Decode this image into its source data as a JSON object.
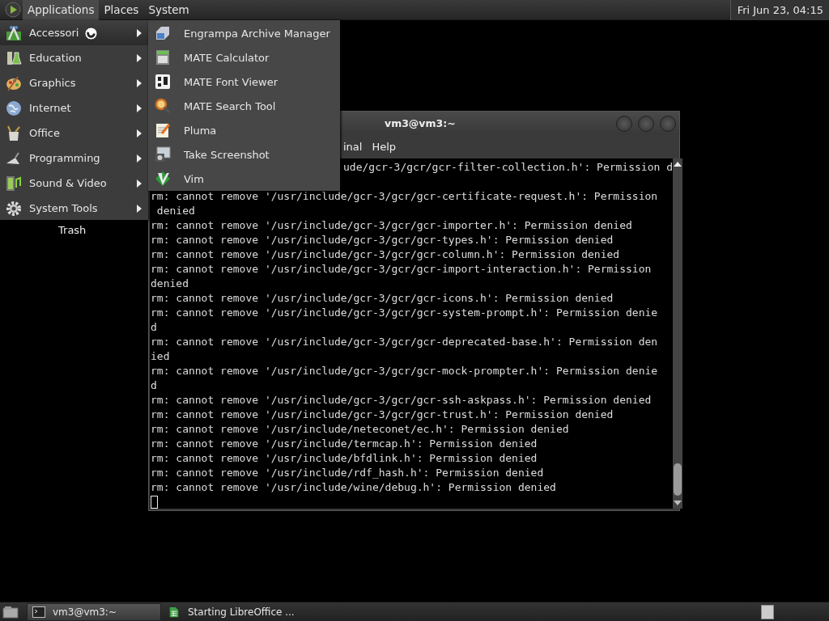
{
  "top_panel": {
    "menus": [
      {
        "label": "Applications",
        "selected": true
      },
      {
        "label": "Places",
        "selected": false
      },
      {
        "label": "System",
        "selected": false
      }
    ],
    "clock": "Fri Jun 23, 04:15"
  },
  "applications_menu": {
    "items": [
      {
        "label": "Accessori",
        "kind": "accessories",
        "selected": true
      },
      {
        "label": "Education",
        "kind": "education",
        "selected": false
      },
      {
        "label": "Graphics",
        "kind": "graphics",
        "selected": false
      },
      {
        "label": "Internet",
        "kind": "internet",
        "selected": false
      },
      {
        "label": "Office",
        "kind": "office",
        "selected": false
      },
      {
        "label": "Programming",
        "kind": "programming",
        "selected": false
      },
      {
        "label": "Sound & Video",
        "kind": "sound_video",
        "selected": false
      },
      {
        "label": "System Tools",
        "kind": "system",
        "selected": false
      }
    ]
  },
  "submenu": {
    "items": [
      {
        "label": "Engrampa Archive Manager",
        "kind": "archive"
      },
      {
        "label": "MATE Calculator",
        "kind": "calculator"
      },
      {
        "label": "MATE Font Viewer",
        "kind": "font"
      },
      {
        "label": "MATE Search Tool",
        "kind": "search"
      },
      {
        "label": "Pluma",
        "kind": "editor"
      },
      {
        "label": "Take Screenshot",
        "kind": "screenshot"
      },
      {
        "label": "Vim",
        "kind": "vim"
      }
    ]
  },
  "desktop_icons": [
    {
      "label": "Trash"
    }
  ],
  "terminal": {
    "title": "vm3@vm3:~",
    "menus": [
      "inal",
      "Help"
    ],
    "first_line": "ude/gcr-3/gcr/gcr-filter-collection.h': Permission d",
    "lines": [
      "rm: cannot remove '/usr/include/gcr-3/gcr/gcr-certificate-request.h': Permission",
      " denied",
      "rm: cannot remove '/usr/include/gcr-3/gcr/gcr-importer.h': Permission denied",
      "rm: cannot remove '/usr/include/gcr-3/gcr/gcr-types.h': Permission denied",
      "rm: cannot remove '/usr/include/gcr-3/gcr/gcr-column.h': Permission denied",
      "rm: cannot remove '/usr/include/gcr-3/gcr/gcr-import-interaction.h': Permission",
      "denied",
      "rm: cannot remove '/usr/include/gcr-3/gcr/gcr-icons.h': Permission denied",
      "rm: cannot remove '/usr/include/gcr-3/gcr/gcr-system-prompt.h': Permission denie",
      "d",
      "rm: cannot remove '/usr/include/gcr-3/gcr/gcr-deprecated-base.h': Permission den",
      "ied",
      "rm: cannot remove '/usr/include/gcr-3/gcr/gcr-mock-prompter.h': Permission denie",
      "d",
      "rm: cannot remove '/usr/include/gcr-3/gcr/gcr-ssh-askpass.h': Permission denied",
      "rm: cannot remove '/usr/include/gcr-3/gcr/gcr-trust.h': Permission denied",
      "rm: cannot remove '/usr/include/neteconet/ec.h': Permission denied",
      "rm: cannot remove '/usr/include/termcap.h': Permission denied",
      "rm: cannot remove '/usr/include/bfdlink.h': Permission denied",
      "rm: cannot remove '/usr/include/rdf_hash.h': Permission denied",
      "rm: cannot remove '/usr/include/wine/debug.h': Permission denied"
    ]
  },
  "taskbar": {
    "tasks": [
      {
        "label": "vm3@vm3:~",
        "kind": "terminal",
        "selected": true
      },
      {
        "label": "Starting LibreOffice ...",
        "kind": "spreadsheet",
        "selected": false
      }
    ]
  }
}
